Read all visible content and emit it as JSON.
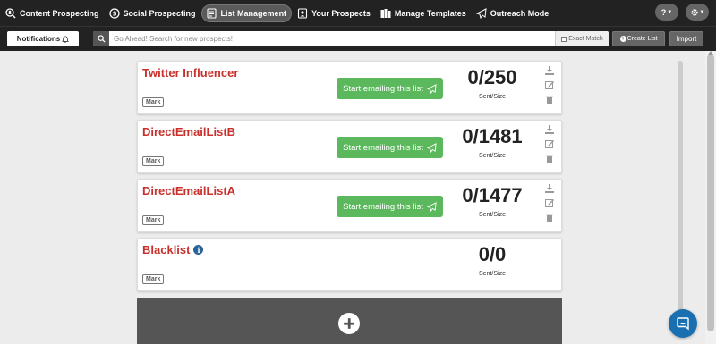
{
  "nav": {
    "items": [
      {
        "label": "Content Prospecting",
        "icon": "search-people-icon",
        "active": false
      },
      {
        "label": "Social Prospecting",
        "icon": "chat-dollar-icon",
        "active": false
      },
      {
        "label": "List Management",
        "icon": "list-edit-icon",
        "active": true
      },
      {
        "label": "Your Prospects",
        "icon": "contact-card-icon",
        "active": false
      },
      {
        "label": "Manage Templates",
        "icon": "templates-icon",
        "active": false
      },
      {
        "label": "Outreach Mode",
        "icon": "paper-plane-icon",
        "active": false
      }
    ],
    "help_label": "?",
    "settings_icon": "gear-icon"
  },
  "toolbar": {
    "notifications_label": "Notifications",
    "search_placeholder": "Go Ahead! Search for new prospects!",
    "exact_match_label": "Exact Match",
    "create_list_label": "Create List",
    "import_label": "Import"
  },
  "lists": [
    {
      "name": "Twitter Influencer",
      "tag": "Mark",
      "button_label": "Start emailing this list",
      "count": "0/250",
      "count_label": "Sent/Size",
      "has_actions": true,
      "info": false
    },
    {
      "name": "DirectEmailListB",
      "tag": "Mark",
      "button_label": "Start emailing this list",
      "count": "0/1481",
      "count_label": "Sent/Size",
      "has_actions": true,
      "info": false
    },
    {
      "name": "DirectEmailListA",
      "tag": "Mark",
      "button_label": "Start emailing this list",
      "count": "0/1477",
      "count_label": "Sent/Size",
      "has_actions": true,
      "info": false
    },
    {
      "name": "Blacklist",
      "tag": "Mark",
      "button_label": "",
      "count": "0/0",
      "count_label": "Sent/Size",
      "has_actions": false,
      "info": true
    }
  ],
  "colors": {
    "nav_bg": "#222222",
    "list_title": "#c9302c",
    "email_button": "#5cb85c",
    "add_panel": "#555555",
    "chat_bubble": "#1a6fb0"
  }
}
